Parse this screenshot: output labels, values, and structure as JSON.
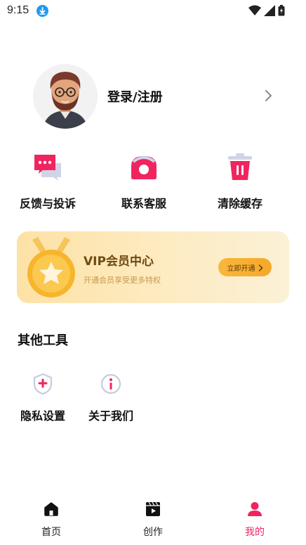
{
  "status_bar": {
    "time": "9:15"
  },
  "profile": {
    "login_label": "登录/注册"
  },
  "quick_actions": [
    {
      "label": "反馈与投诉",
      "icon": "chat-icon"
    },
    {
      "label": "联系客服",
      "icon": "phone-icon"
    },
    {
      "label": "清除缓存",
      "icon": "trash-icon"
    }
  ],
  "vip": {
    "title": "VIP会员中心",
    "subtitle": "开通会员享受更多特权",
    "button_label": "立即开通"
  },
  "other_tools": {
    "title": "其他工具",
    "items": [
      {
        "label": "隐私设置",
        "icon": "shield-plus-icon"
      },
      {
        "label": "关于我们",
        "icon": "info-icon"
      }
    ]
  },
  "bottom_nav": [
    {
      "label": "首页",
      "icon": "home-icon"
    },
    {
      "label": "创作",
      "icon": "clapperboard-icon"
    },
    {
      "label": "我的",
      "icon": "user-icon",
      "active": true
    }
  ],
  "colors": {
    "accent": "#f0245f",
    "vip_gold": "#f6a82a",
    "download_blue": "#1e9af0"
  }
}
